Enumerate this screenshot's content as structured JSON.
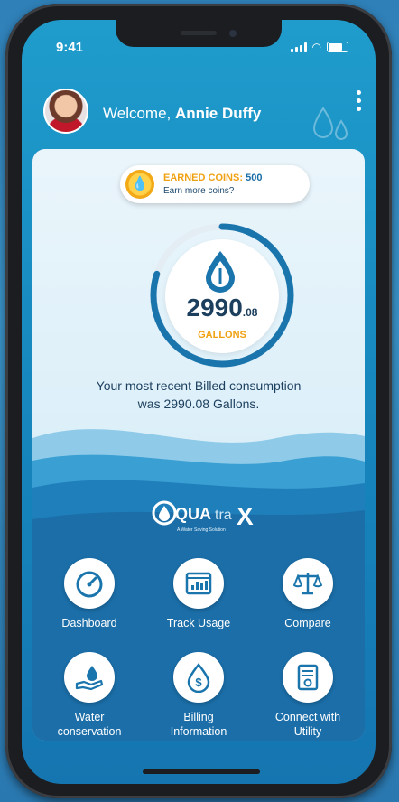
{
  "status": {
    "time": "9:41"
  },
  "header": {
    "welcome_prefix": "Welcome,",
    "user_name": "Annie Duffy"
  },
  "coins": {
    "title": "EARNED COINS:",
    "count": "500",
    "subtitle": "Earn more coins?"
  },
  "consumption": {
    "value_main": "2990",
    "value_decimal": ".08",
    "unit": "GALLONS",
    "message_line1": "Your most recent Billed consumption",
    "message_line2": "was 2990.08 Gallons.",
    "gauge_fraction": 0.8
  },
  "brand": {
    "logo_text_1": "QUA",
    "logo_text_2": "tra",
    "logo_text_3": "X",
    "tagline": "A Water Saving Solution"
  },
  "tiles": [
    {
      "label": "Dashboard",
      "icon": "speedometer-icon"
    },
    {
      "label": "Track Usage",
      "icon": "usage-chart-icon"
    },
    {
      "label": "Compare",
      "icon": "scale-icon"
    },
    {
      "label": "Water conservation",
      "icon": "hand-water-icon"
    },
    {
      "label": "Billing Information",
      "icon": "dollar-drop-icon"
    },
    {
      "label": "Connect with Utility",
      "icon": "utility-document-icon"
    }
  ],
  "colors": {
    "accent_orange": "#f0a112",
    "primary_blue": "#1575b0",
    "dark_text": "#1c3f5e"
  }
}
